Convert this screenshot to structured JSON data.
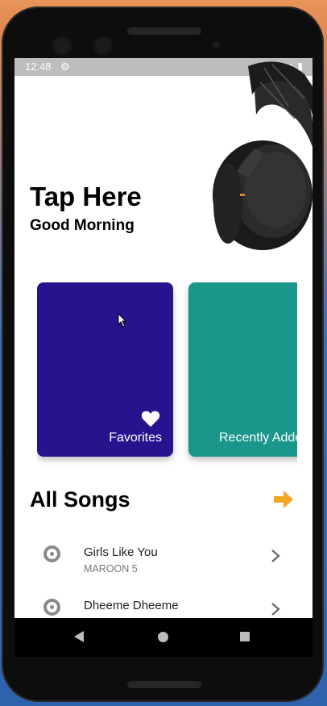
{
  "status_bar": {
    "time": "12:48",
    "gear_icon": "gear-icon",
    "right_icons": "▼ ◢ ▮"
  },
  "hero": {
    "title": "Tap Here",
    "subtitle": "Good Morning"
  },
  "cards": [
    {
      "label": "Favorites",
      "color": "#26148f",
      "icon": "heart-icon"
    },
    {
      "label": "Recently Added",
      "color": "#1a968a",
      "icon": "plus-icon"
    }
  ],
  "section": {
    "title": "All Songs",
    "arrow_icon": "arrow-right-icon",
    "arrow_color": "#f5a623"
  },
  "songs": [
    {
      "title": "Girls Like You",
      "artist": "MAROON 5"
    },
    {
      "title": "Dheeme Dheeme",
      "artist": ""
    }
  ],
  "nav": {
    "back_icon": "back-icon",
    "home_icon": "home-icon",
    "recent_icon": "recents-icon"
  }
}
